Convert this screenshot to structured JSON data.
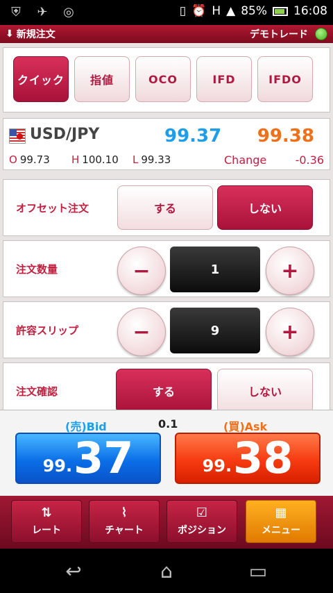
{
  "statusbar": {
    "battery": "85%",
    "time": "16:08",
    "signal": "H"
  },
  "titlebar": {
    "title": "新規注文",
    "mode": "デモトレード"
  },
  "tabs": [
    {
      "label": "クイック",
      "active": true
    },
    {
      "label": "指値",
      "active": false
    },
    {
      "label": "OCO",
      "active": false
    },
    {
      "label": "IFD",
      "active": false
    },
    {
      "label": "IFDO",
      "active": false
    }
  ],
  "price": {
    "pair": "USD/JPY",
    "bid": "99.37",
    "ask": "99.38",
    "open_key": "O",
    "open": "99.73",
    "high_key": "H",
    "high": "100.10",
    "low_key": "L",
    "low": "99.33",
    "change_label": "Change",
    "change": "-0.36"
  },
  "offset": {
    "label": "オフセット注文",
    "on_label": "する",
    "off_label": "しない",
    "selected": "off"
  },
  "quantity": {
    "label": "注文数量",
    "minus": "−",
    "plus": "+",
    "value": "1"
  },
  "slippage": {
    "label": "許容スリップ",
    "minus": "−",
    "plus": "+",
    "value": "9"
  },
  "confirm": {
    "label": "注文確認",
    "on_label": "する",
    "off_label": "しない",
    "selected": "on"
  },
  "quote": {
    "bid_label": "(売)Bid",
    "ask_label": "(買)Ask",
    "spread": "0.1",
    "bid_small": "99.",
    "bid_big": "37",
    "ask_small": "99.",
    "ask_big": "38",
    "colors": {
      "bid": "#1e9ee8",
      "ask": "#f0701a"
    }
  },
  "nav": [
    {
      "label": "レート",
      "icon": "arrows-icon"
    },
    {
      "label": "チャート",
      "icon": "chart-icon"
    },
    {
      "label": "ポジション",
      "icon": "check-icon"
    },
    {
      "label": "メニュー",
      "icon": "grid-icon"
    }
  ]
}
